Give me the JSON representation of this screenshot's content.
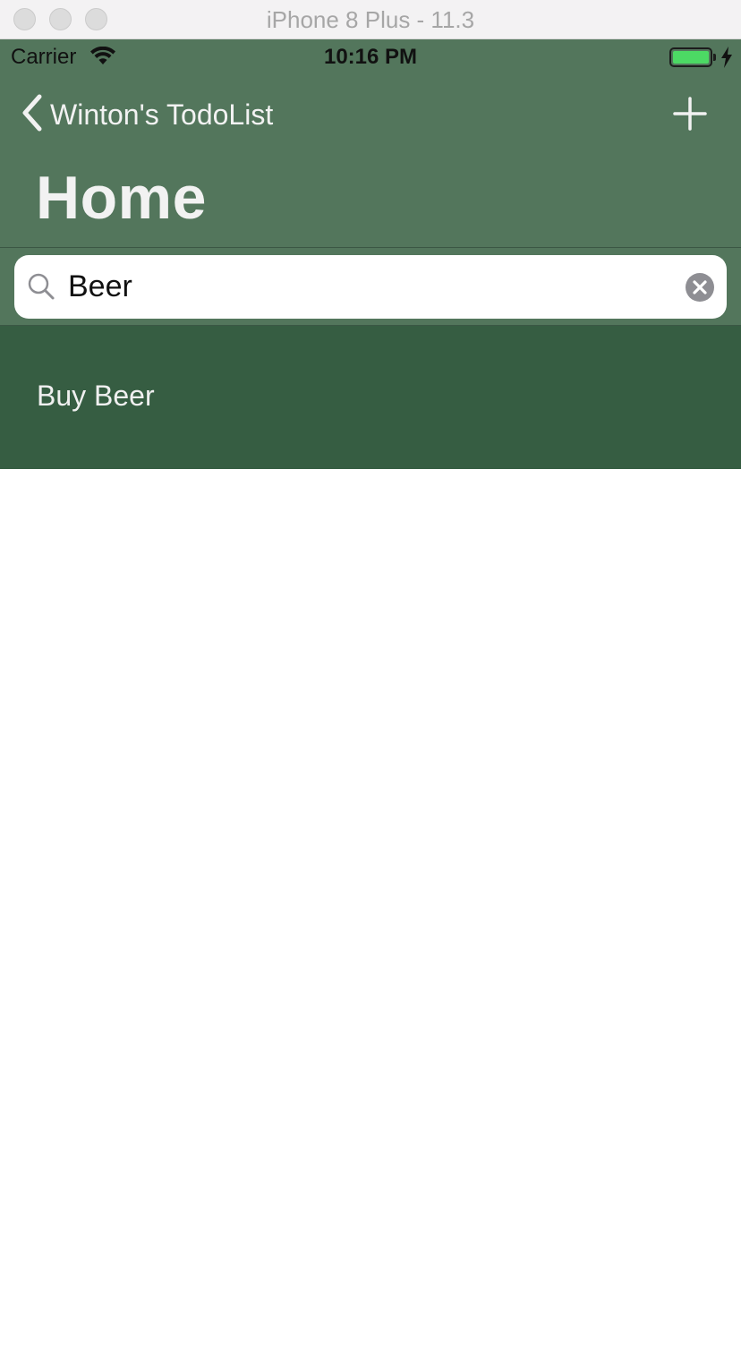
{
  "window": {
    "title": "iPhone 8 Plus - 11.3"
  },
  "status_bar": {
    "carrier": "Carrier",
    "time": "10:16 PM",
    "battery_level": 1.0,
    "charging": true
  },
  "nav": {
    "back_label": "Winton's TodoList",
    "title": "Home",
    "add_icon": "plus-icon"
  },
  "search": {
    "value": "Beer",
    "icon": "magnifier-icon",
    "clear_icon": "clear-x-icon"
  },
  "list": {
    "items": [
      {
        "label": "Buy Beer"
      }
    ]
  },
  "colors": {
    "nav_background": "#53765c",
    "cell_background": "#365d42",
    "battery_fill": "#4cd964"
  }
}
